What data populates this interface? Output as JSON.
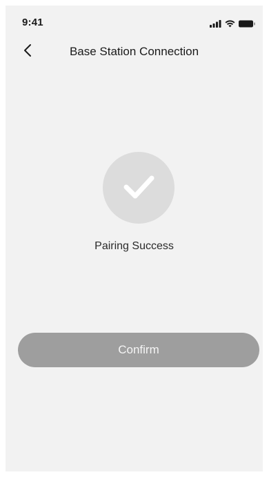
{
  "status_bar": {
    "time": "9:41",
    "icons": [
      "signal-icon",
      "wifi-icon",
      "battery-icon"
    ]
  },
  "nav": {
    "back_icon": "chevron-left-icon",
    "title": "Base Station Connection"
  },
  "result": {
    "icon": "checkmark-icon",
    "message": "Pairing Success"
  },
  "actions": {
    "confirm_label": "Confirm"
  },
  "colors": {
    "background": "#f2f2f2",
    "circle": "#dcdcdc",
    "button": "#9e9e9e",
    "button_text": "#f5f5f5"
  }
}
